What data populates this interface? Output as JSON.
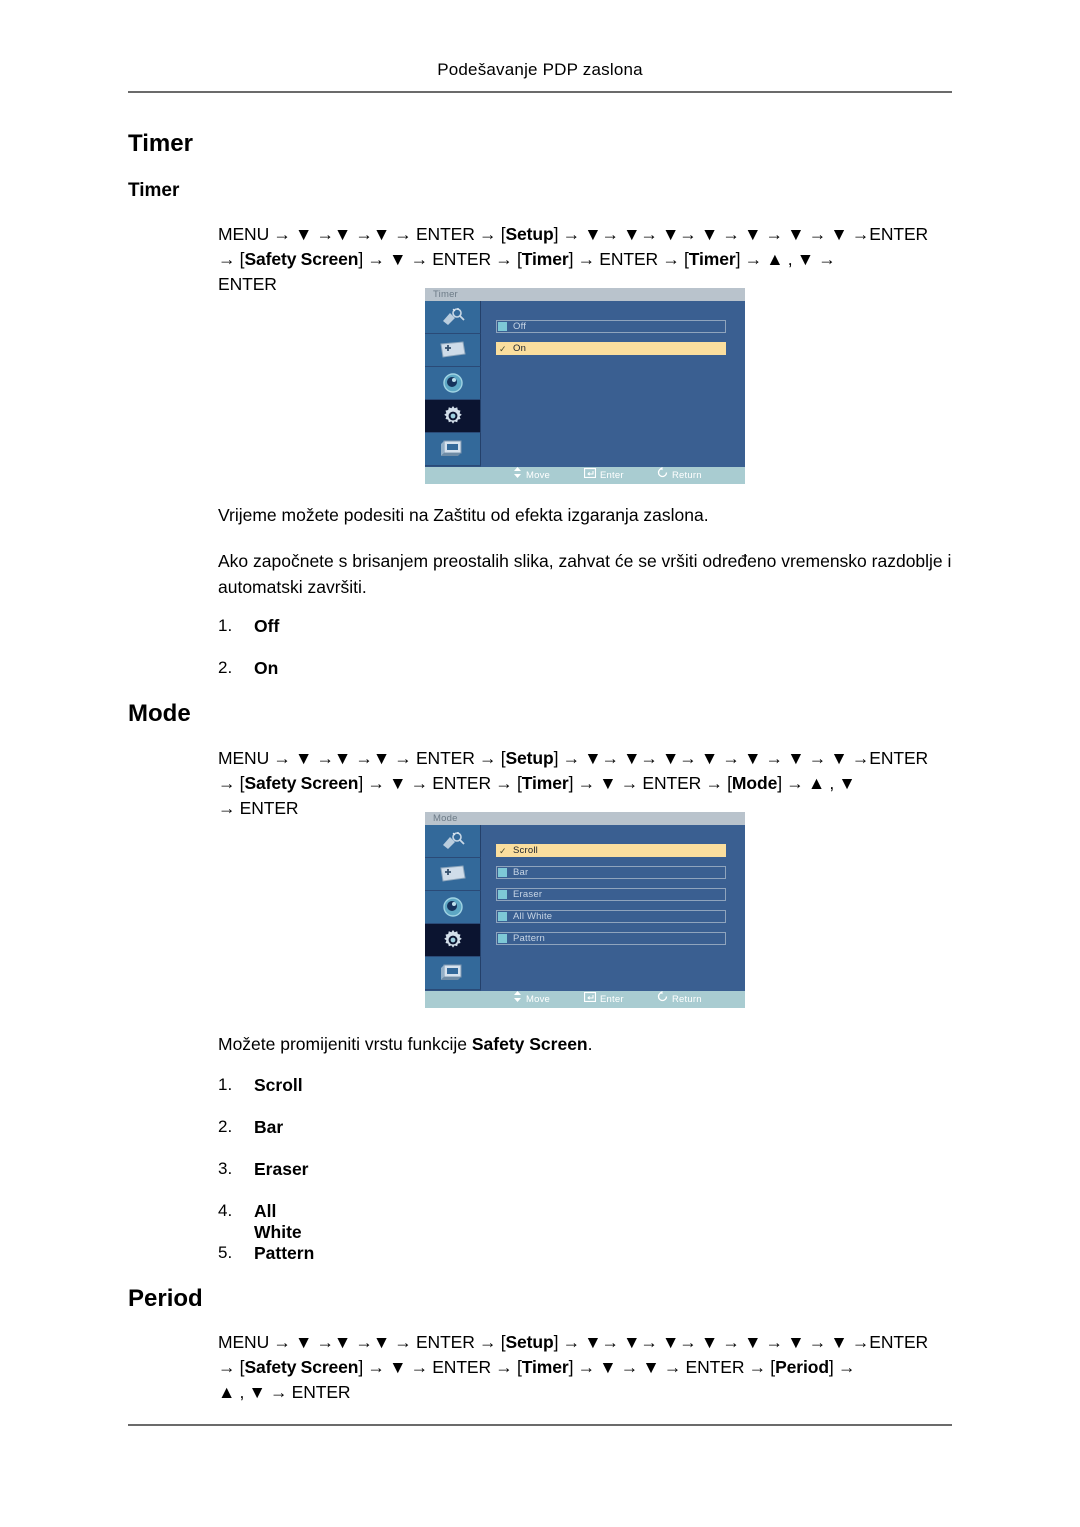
{
  "header": {
    "running_title": "Podešavanje PDP zaslona"
  },
  "sections": [
    {
      "heading": "Timer",
      "subheading": "Timer",
      "nav_path": {
        "line1": "MENU → ▼ →▼ →▼ → ENTER → [Setup] → ▼→ ▼→ ▼→ ▼ → ▼ → ▼ → ▼ →ENTER",
        "line2": "→ [Safety Screen] → ▼ → ENTER → [Timer] → ENTER → [Timer] → ▲ , ▼ →",
        "line3": "ENTER"
      },
      "paragraphs": [
        "Vrijeme možete podesiti na Zaštitu od efekta izgaranja zaslona.",
        "Ako započnete s brisanjem preostalih slika, zahvat će se vršiti određeno vremensko razdoblje i automatski završiti."
      ],
      "list": [
        {
          "num": "1.",
          "label": "Off"
        },
        {
          "num": "2.",
          "label": "On"
        }
      ],
      "osd": {
        "title": "Timer",
        "rows": [
          {
            "label": "Off",
            "selected": false
          },
          {
            "label": "On",
            "selected": true
          }
        ],
        "footer": [
          {
            "icon": "updown-arrow-icon",
            "label": "Move"
          },
          {
            "icon": "enter-key-icon",
            "label": "Enter"
          },
          {
            "icon": "return-arrow-icon",
            "label": "Return"
          }
        ]
      }
    },
    {
      "heading": "Mode",
      "subheading": "",
      "nav_path": {
        "line1": "MENU → ▼ →▼ →▼ → ENTER → [Setup] → ▼→ ▼→ ▼→ ▼ → ▼ → ▼ → ▼ →ENTER",
        "line2": "→ [Safety Screen] → ▼ → ENTER → [Timer] → ▼ → ENTER → [Mode] → ▲ , ▼",
        "line3": "→ ENTER"
      },
      "paragraphs": [
        "Možete promijeniti vrstu funkcije Safety Screen."
      ],
      "list": [
        {
          "num": "1.",
          "label": "Scroll"
        },
        {
          "num": "2.",
          "label": "Bar"
        },
        {
          "num": "3.",
          "label": "Eraser"
        },
        {
          "num": "4.",
          "label": "All White"
        },
        {
          "num": "5.",
          "label": "Pattern"
        }
      ],
      "osd": {
        "title": "Mode",
        "rows": [
          {
            "label": "Scroll",
            "selected": true
          },
          {
            "label": "Bar",
            "selected": false
          },
          {
            "label": "Eraser",
            "selected": false
          },
          {
            "label": "All White",
            "selected": false
          },
          {
            "label": "Pattern",
            "selected": false
          }
        ],
        "footer": [
          {
            "icon": "updown-arrow-icon",
            "label": "Move"
          },
          {
            "icon": "enter-key-icon",
            "label": "Enter"
          },
          {
            "icon": "return-arrow-icon",
            "label": "Return"
          }
        ]
      }
    },
    {
      "heading": "Period",
      "subheading": "",
      "nav_path": {
        "line1": "MENU → ▼ →▼ →▼ → ENTER → [Setup] → ▼→ ▼→ ▼→ ▼ → ▼ → ▼ → ▼ →ENTER",
        "line2": "→ [Safety Screen] → ▼ → ENTER → [Timer] → ▼ → ▼ → ENTER → [Period] →",
        "line3": "▲ , ▼ → ENTER"
      },
      "paragraphs": [],
      "list": [],
      "osd": null
    }
  ],
  "osd_sidebar_icons": [
    "satellite-input-icon",
    "picture-icon",
    "sound-icon",
    "setup-gear-icon",
    "multi-control-icon"
  ],
  "colors": {
    "osd_background": "#3a5f91",
    "osd_sidebar": "#33699a",
    "osd_sidebar_selected": "#0b1430",
    "osd_titlebar": "#b9c3cc",
    "osd_highlight": "#fade9e",
    "osd_footer": "#a9ccd1",
    "osd_chip": "#7ec8d6",
    "rule": "#6b6b6b"
  }
}
